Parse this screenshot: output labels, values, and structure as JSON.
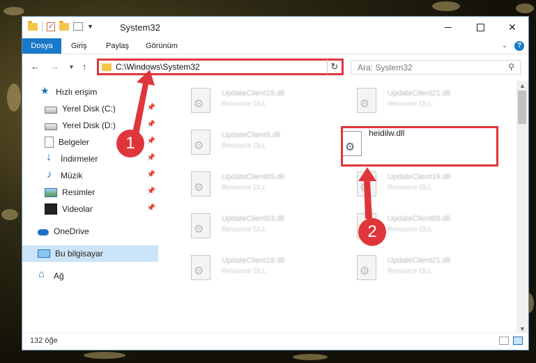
{
  "window": {
    "title": "System32",
    "buttons": {
      "minimize": "—",
      "maximize": "□",
      "close": "✕"
    }
  },
  "ribbon": {
    "tabs": [
      "Dosya",
      "Giriş",
      "Paylaş",
      "Görünüm"
    ],
    "help": "?"
  },
  "navigation": {
    "address": "C:\\Windows\\System32",
    "search_placeholder": "Ara: System32"
  },
  "sidebar": {
    "items": [
      {
        "label": "Hızlı erişim",
        "icon": "star-icon"
      },
      {
        "label": "Yerel Disk (C:)",
        "icon": "drive-icon",
        "pinned": true
      },
      {
        "label": "Yerel Disk (D:)",
        "icon": "drive-icon",
        "pinned": true
      },
      {
        "label": "Belgeler",
        "icon": "document-icon",
        "pinned": true
      },
      {
        "label": "İndirmeler",
        "icon": "download-icon",
        "pinned": true
      },
      {
        "label": "Müzik",
        "icon": "music-icon",
        "pinned": true
      },
      {
        "label": "Resimler",
        "icon": "pictures-icon",
        "pinned": true
      },
      {
        "label": "Videolar",
        "icon": "video-icon",
        "pinned": true
      },
      {
        "label": "OneDrive",
        "icon": "cloud-icon"
      },
      {
        "label": "Bu bilgisayar",
        "icon": "computer-icon",
        "selected": true
      },
      {
        "label": "Ağ",
        "icon": "network-icon"
      }
    ]
  },
  "files": [
    {
      "name": "UpdateClient19.dll",
      "desc": "Resource DLL"
    },
    {
      "name": "UpdateClient21.dll",
      "desc": "Resource DLL"
    },
    {
      "name": "UpdateClient5.dll",
      "desc": "Resource DLL"
    },
    {
      "name": "heidilw.dll",
      "desc": ""
    },
    {
      "name": "UpdateClient65.dll",
      "desc": "Resource DLL"
    },
    {
      "name": "UpdateClient19.dll",
      "desc": "Resource DLL"
    },
    {
      "name": "UpdateClient63.dll",
      "desc": "Resource DLL"
    },
    {
      "name": "UpdateClient65.dll",
      "desc": "Resource DLL"
    },
    {
      "name": "UpdateClient19.dll",
      "desc": "Resource DLL"
    },
    {
      "name": "UpdateClient21.dll",
      "desc": "Resource DLL"
    }
  ],
  "status": {
    "count": "132 öğe"
  },
  "annotations": {
    "step1": "1",
    "step2": "2"
  },
  "colors": {
    "accent": "#1979ca",
    "highlight": "#e0353a"
  }
}
